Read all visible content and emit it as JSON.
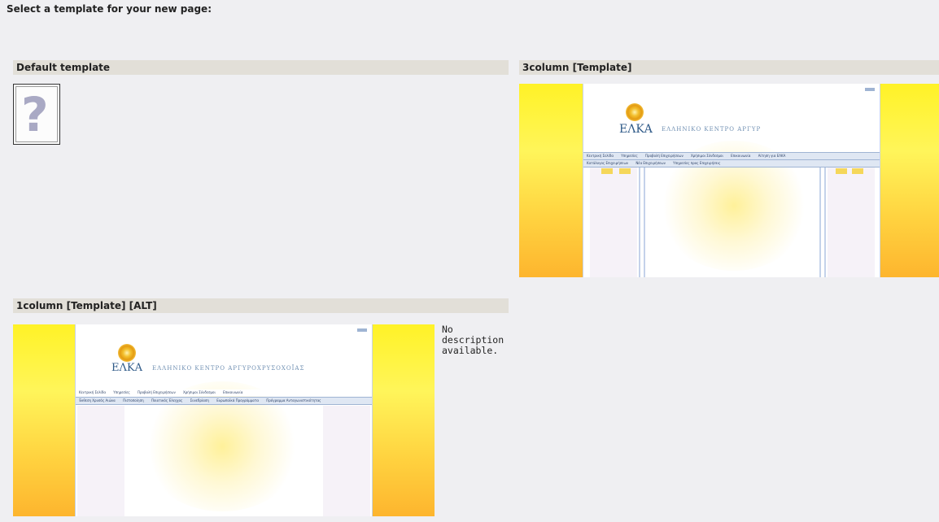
{
  "page": {
    "heading": "Select a template for your new page:",
    "no_description": "No description available."
  },
  "templates": [
    {
      "title": "Default template",
      "preview_icon": "question-mark-icon"
    },
    {
      "title": "3column [Template]",
      "preview": {
        "logo": "ΕΛΚΑ",
        "logo_sub": "ΕΛΛΗΝΙΚΟ ΚΕΝΤΡΟ ΑΡΓΥΡ",
        "nav_row1": [
          "Κεντρική Σελίδα",
          "Υπηρεσίες",
          "Προβολή Επιχειρήσεων",
          "Χρήσιμοι Σύνδεσμοι",
          "Επικοινωνία",
          "Αίτηση για ΕΛΚΑ"
        ],
        "nav_row2": [
          "Κατάλογος Επιχειρήσεων",
          "Νέα Επιχειρήσεων",
          "Υπηρεσίες προς Επιχειρήσεις"
        ]
      }
    },
    {
      "title": "1column [Template] [ALT]",
      "preview": {
        "logo": "ΕΛΚΑ",
        "logo_sub": "ΕΛΛΗΝΙΚΟ ΚΕΝΤΡΟ ΑΡΓΥΡΟΧΡΥΣΟΧΟΪΑΣ",
        "nav_row1": [
          "Κεντρική Σελίδα",
          "Υπηρεσίες",
          "Προβολή Επιχειρήσεων",
          "Χρήσιμοι Σύνδεσμοι",
          "Επικοινωνία"
        ],
        "nav_row2": [
          "Έκθεση Χρυσός Αιώνα",
          "Πιστοποίηση",
          "Ποιοτικός Έλεγχος",
          "Συνεδρίαση",
          "Ευρωπαϊκά Προγράμματα",
          "Πρόγραμμα Ανταγωνιστικότητας"
        ]
      }
    }
  ]
}
